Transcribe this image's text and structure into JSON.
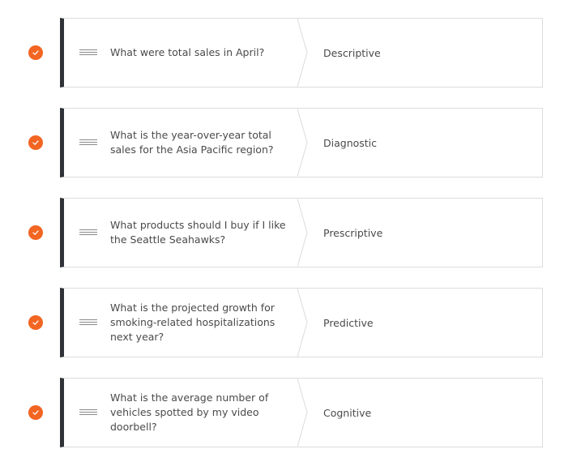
{
  "colors": {
    "accent": "#f26522",
    "card_bar": "#2f3337",
    "border": "#dcdcdc",
    "text": "#4a4a4a"
  },
  "icons": {
    "status": "check-circle-icon",
    "handle": "drag-handle-icon"
  },
  "items": [
    {
      "question": "What were total sales in April?",
      "category": "Descriptive",
      "checked": true
    },
    {
      "question": "What is the year-over-year total sales for the Asia Pacific region?",
      "category": "Diagnostic",
      "checked": true
    },
    {
      "question": "What products should I buy if I like the Seattle Seahawks?",
      "category": "Prescriptive",
      "checked": true
    },
    {
      "question": "What is the projected growth for smoking-related hospitalizations next year?",
      "category": "Predictive",
      "checked": true
    },
    {
      "question": "What is the average number of vehicles spotted by my video doorbell?",
      "category": "Cognitive",
      "checked": true
    }
  ]
}
